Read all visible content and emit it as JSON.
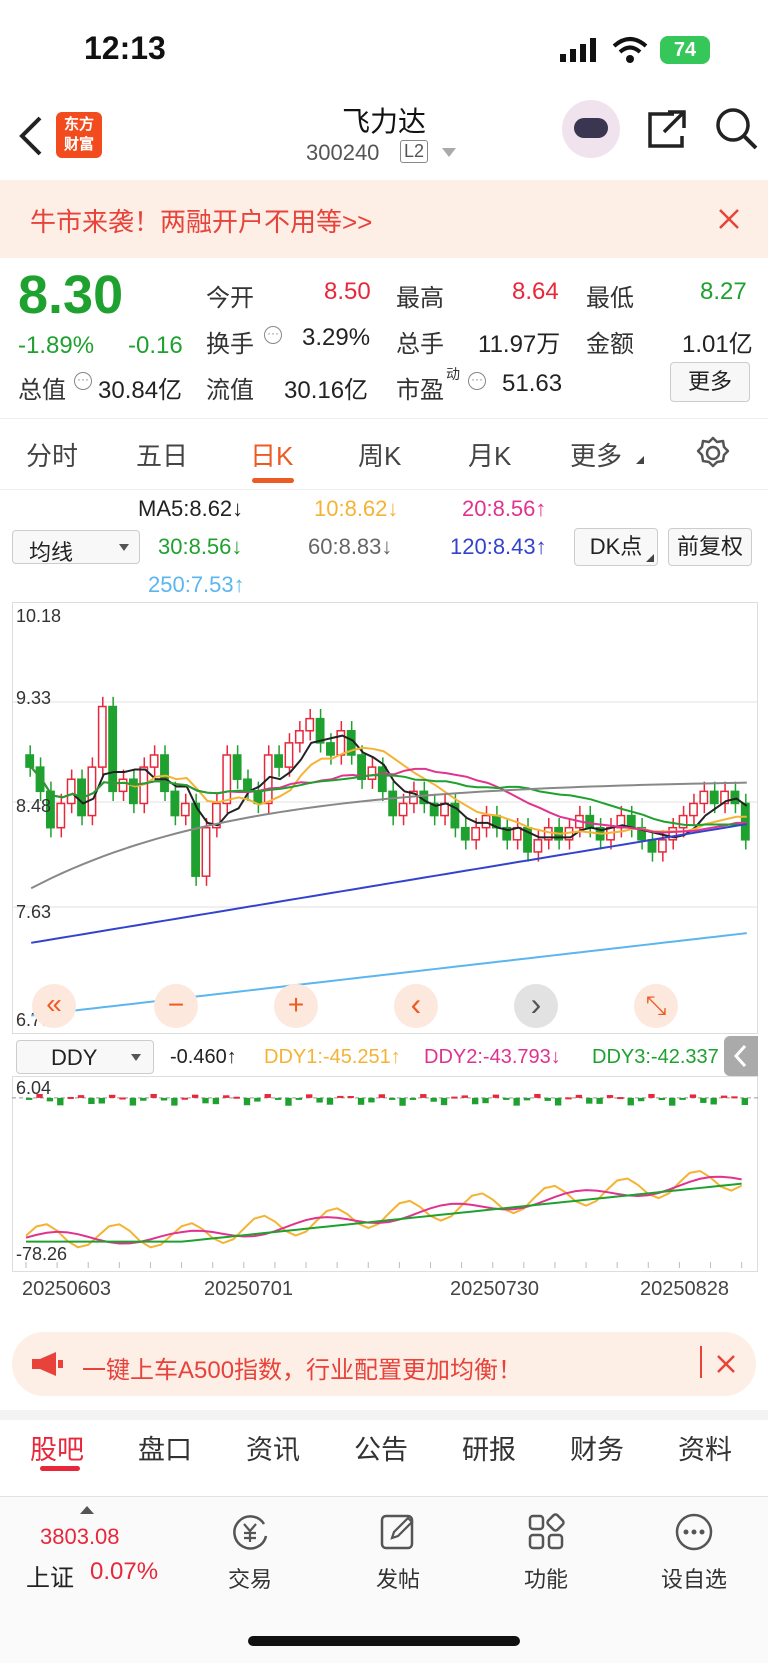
{
  "status": {
    "time": "12:13",
    "battery": "74"
  },
  "header": {
    "title": "飞力达",
    "code": "300240",
    "level": "L2",
    "logo_line1": "东方",
    "logo_line2": "财富"
  },
  "banner": {
    "text": "牛市来袭！两融开户不用等>>"
  },
  "quote": {
    "price": "8.30",
    "change_pct": "-1.89%",
    "change": "-0.16",
    "open_label": "今开",
    "open": "8.50",
    "high_label": "最高",
    "high": "8.64",
    "low_label": "最低",
    "low": "8.27",
    "turnover_label": "换手",
    "turnover": "3.29%",
    "volume_label": "总手",
    "volume": "11.97万",
    "amount_label": "金额",
    "amount": "1.01亿",
    "mktcap_label": "总值",
    "mktcap": "30.84亿",
    "float_label": "流值",
    "float": "30.16亿",
    "pe_label": "市盈",
    "pe_sup": "动",
    "pe": "51.63",
    "more": "更多"
  },
  "tabs": [
    "分时",
    "五日",
    "日K",
    "周K",
    "月K",
    "更多"
  ],
  "ma": {
    "select": "均线",
    "ma5": "MA5:8.62↓",
    "ma10": "10:8.62↓",
    "ma20": "20:8.56↑",
    "ma30": "30:8.56↓",
    "ma60": "60:8.83↓",
    "ma120": "120:8.43↑",
    "ma250": "250:7.53↑",
    "dk": "DK点",
    "fq": "前复权",
    "colors": {
      "ma5": "#222222",
      "ma10": "#f5b335",
      "ma20": "#e0338f",
      "ma30": "#1ea12f",
      "ma60": "#888888",
      "ma120": "#3344cc",
      "ma250": "#5bb6f0"
    }
  },
  "kline_axis": [
    "10.18",
    "9.33",
    "8.48",
    "7.63",
    "6.78"
  ],
  "chart_controls": [
    "«",
    "−",
    "+",
    "‹",
    "›",
    "⤡"
  ],
  "ddy": {
    "select": "DDY",
    "value": "-0.460↑",
    "ddy1": "DDY1:-45.251↑",
    "ddy2": "DDY2:-43.793↓",
    "ddy3": "DDY3:-42.337",
    "axis_top": "6.04",
    "axis_bottom": "-78.26"
  },
  "dates": [
    "20250603",
    "20250701",
    "20250730",
    "20250828"
  ],
  "promo": {
    "text": "一键上车A500指数，行业配置更加均衡！"
  },
  "subtabs": [
    "股吧",
    "盘口",
    "资讯",
    "公告",
    "研报",
    "财务",
    "资料"
  ],
  "bottom": {
    "index_value": "3803.08",
    "index_name": "上证",
    "index_change": "0.07%",
    "nav": [
      "交易",
      "发帖",
      "功能",
      "设自选"
    ]
  },
  "chart_data": {
    "type": "candlestick",
    "price_axis_ticks": [
      10.18,
      9.33,
      8.48,
      7.63,
      6.78
    ],
    "ma_latest": {
      "MA5": 8.62,
      "MA10": 8.62,
      "MA20": 8.56,
      "MA30": 8.56,
      "MA60": 8.83,
      "MA120": 8.43,
      "MA250": 7.53
    },
    "last_close": 8.3,
    "x_ticks": [
      "20250603",
      "20250701",
      "20250730",
      "20250828"
    ],
    "ddy": {
      "DDY": -0.46,
      "DDY1": -45.251,
      "DDY2": -43.793,
      "DDY3": -42.337,
      "ylim": [
        -78.26,
        6.04
      ]
    }
  }
}
